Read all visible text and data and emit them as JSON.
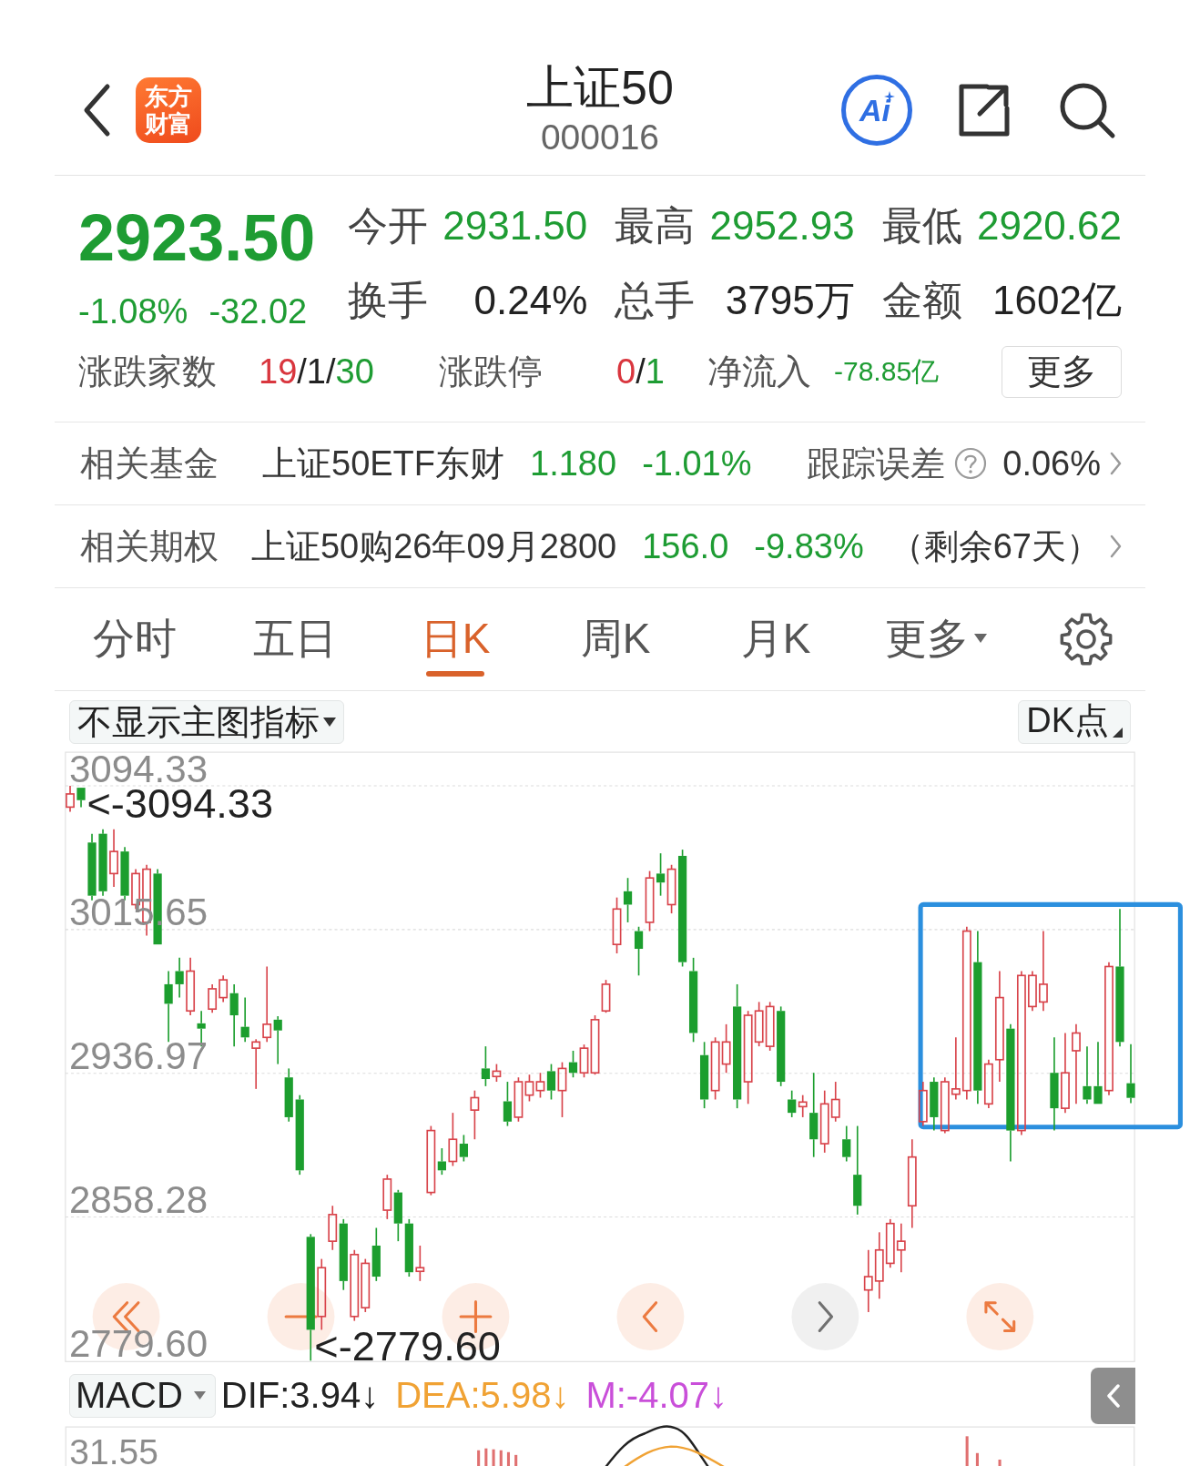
{
  "header": {
    "logo_text": "东方财富",
    "title": "上证50",
    "code": "000016",
    "ai_label": "Ai"
  },
  "quote": {
    "price": "2923.50",
    "color": "#1e9c33",
    "change_percent": "-1.08%",
    "change": "-32.02",
    "stats": [
      {
        "label": "今开",
        "value": "2931.50",
        "color": "#1e9c33"
      },
      {
        "label": "最高",
        "value": "2952.93",
        "color": "#1e9c33"
      },
      {
        "label": "最低",
        "value": "2920.62",
        "color": "#1e9c33"
      },
      {
        "label": "换手",
        "value": "0.24%",
        "color": "#222222"
      },
      {
        "label": "总手",
        "value": "3795万",
        "color": "#222222"
      },
      {
        "label": "金额",
        "value": "1602亿",
        "color": "#222222"
      }
    ],
    "breadth": {
      "label": "涨跌家数",
      "parts": [
        {
          "text": "19",
          "color": "#d9363e"
        },
        {
          "text": "/1/",
          "color": "#222222"
        },
        {
          "text": "30",
          "color": "#1e9c33"
        }
      ]
    },
    "limits": {
      "label": "涨跌停",
      "parts": [
        {
          "text": "0",
          "color": "#d9363e"
        },
        {
          "text": "/",
          "color": "#222222"
        },
        {
          "text": "1",
          "color": "#1e9c33"
        }
      ]
    },
    "net_inflow": {
      "label": "净流入",
      "value": "-78.85亿",
      "color": "#1e9c33"
    },
    "more_button": "更多"
  },
  "related": [
    {
      "label": "相关基金",
      "name": "上证50ETF东财",
      "price": "1.180",
      "change": "-1.01%",
      "color": "#1e9c33",
      "extra_label": "跟踪误差",
      "help": true,
      "extra_value": "0.06%"
    },
    {
      "label": "相关期权",
      "name": "上证50购26年09月2800",
      "price": "156.0",
      "change": "-9.83%",
      "color": "#1e9c33",
      "help": false,
      "extra_value": "（剩余67天）"
    }
  ],
  "tabs": [
    {
      "label": "分时",
      "kind": "period",
      "selected": false
    },
    {
      "label": "五日",
      "kind": "period",
      "selected": false
    },
    {
      "label": "日K",
      "kind": "period",
      "selected": true
    },
    {
      "label": "周K",
      "kind": "period",
      "selected": false
    },
    {
      "label": "月K",
      "kind": "period",
      "selected": false
    },
    {
      "label": "更多",
      "kind": "menu",
      "selected": false
    }
  ],
  "chart": {
    "indicator_menu": "不显示主图指标",
    "dk_button": "DK点",
    "high_marker": "<-3094.33",
    "low_marker": "<-2779.60",
    "chart_data": {
      "type": "candlestick",
      "ohlc": [
        [
          3082.7,
          3094.33,
          3080.2,
          3089.9
        ],
        [
          3093.3,
          3093.3,
          3082.7,
          3086.5
        ],
        [
          3063.3,
          3068.1,
          3031.7,
          3034.2
        ],
        [
          3068.1,
          3070.5,
          3034.2,
          3036.6
        ],
        [
          3046.3,
          3070.5,
          3039.0,
          3058.4
        ],
        [
          3058.4,
          3060.8,
          3031.7,
          3034.2
        ],
        [
          3029.3,
          3048.7,
          3026.9,
          3046.3
        ],
        [
          3019.6,
          3051.1,
          3012.3,
          3048.7
        ],
        [
          3046.3,
          3048.7,
          3007.5,
          3007.5
        ],
        [
          2985.7,
          2992.9,
          2954.1,
          2975.0
        ],
        [
          2992.9,
          3000.2,
          2978.4,
          2985.7
        ],
        [
          2971.1,
          3000.2,
          2968.7,
          2992.9
        ],
        [
          2964.3,
          2971.1,
          2951.7,
          2961.4
        ],
        [
          2972.1,
          2985.7,
          2970.1,
          2983.2
        ],
        [
          2978.4,
          2990.5,
          2976.0,
          2988.1
        ],
        [
          2980.8,
          2985.7,
          2951.7,
          2968.7
        ],
        [
          2962.4,
          2978.4,
          2954.1,
          2956.6
        ],
        [
          2950.7,
          2955.6,
          2928.4,
          2954.1
        ],
        [
          2956.6,
          2995.4,
          2954.1,
          2963.8
        ],
        [
          2966.3,
          2968.2,
          2942.0,
          2960.4
        ],
        [
          2934.7,
          2939.6,
          2910.5,
          2912.9
        ],
        [
          2922.6,
          2925.0,
          2881.4,
          2883.8
        ],
        [
          2847.4,
          2848.9,
          2779.6,
          2796.5
        ],
        [
          2803.8,
          2835.3,
          2796.5,
          2830.5
        ],
        [
          2845.0,
          2864.4,
          2840.2,
          2859.6
        ],
        [
          2854.7,
          2857.1,
          2818.3,
          2823.2
        ],
        [
          2803.8,
          2840.2,
          2801.4,
          2837.7
        ],
        [
          2808.6,
          2835.3,
          2806.2,
          2832.9
        ],
        [
          2842.6,
          2852.3,
          2823.2,
          2825.6
        ],
        [
          2862.0,
          2881.4,
          2857.1,
          2879.0
        ],
        [
          2871.7,
          2873.1,
          2845.0,
          2854.7
        ],
        [
          2854.7,
          2857.1,
          2825.6,
          2828.0
        ],
        [
          2828.5,
          2842.6,
          2823.2,
          2830.5
        ],
        [
          2871.7,
          2908.1,
          2870.2,
          2905.6
        ],
        [
          2888.7,
          2895.9,
          2881.4,
          2883.8
        ],
        [
          2888.7,
          2915.3,
          2886.2,
          2900.8
        ],
        [
          2898.4,
          2903.2,
          2888.7,
          2891.1
        ],
        [
          2916.8,
          2927.5,
          2900.8,
          2923.6
        ],
        [
          2939.6,
          2951.7,
          2929.9,
          2933.8
        ],
        [
          2935.2,
          2942.0,
          2932.3,
          2938.1
        ],
        [
          2921.6,
          2932.3,
          2908.1,
          2910.5
        ],
        [
          2912.9,
          2934.7,
          2910.5,
          2932.3
        ],
        [
          2925.0,
          2936.2,
          2921.6,
          2932.3
        ],
        [
          2927.5,
          2937.2,
          2923.6,
          2932.3
        ],
        [
          2938.1,
          2942.0,
          2922.6,
          2927.5
        ],
        [
          2927.5,
          2943.0,
          2912.9,
          2939.6
        ],
        [
          2943.0,
          2949.3,
          2934.7,
          2937.2
        ],
        [
          2937.2,
          2952.7,
          2934.7,
          2950.7
        ],
        [
          2937.2,
          2968.7,
          2936.2,
          2966.3
        ],
        [
          2971.1,
          2988.1,
          2970.1,
          2985.7
        ],
        [
          3007.5,
          3033.2,
          3002.6,
          3026.9
        ],
        [
          3036.6,
          3043.9,
          3019.6,
          3029.3
        ],
        [
          3014.8,
          3017.2,
          2990.5,
          3005.1
        ],
        [
          3019.6,
          3047.7,
          3014.8,
          3043.9
        ],
        [
          3046.3,
          3057.4,
          3034.2,
          3041.4
        ],
        [
          3029.3,
          3051.1,
          3024.5,
          3048.7
        ],
        [
          3056.0,
          3059.4,
          2995.4,
          2997.8
        ],
        [
          2992.9,
          3000.2,
          2954.1,
          2959.0
        ],
        [
          2946.9,
          2954.1,
          2917.8,
          2922.6
        ],
        [
          2927.5,
          2956.6,
          2922.6,
          2954.1
        ],
        [
          2942.0,
          2963.8,
          2937.2,
          2954.1
        ],
        [
          2973.5,
          2985.7,
          2917.8,
          2922.6
        ],
        [
          2932.3,
          2971.1,
          2920.2,
          2968.7
        ],
        [
          2954.1,
          2976.0,
          2951.7,
          2971.1
        ],
        [
          2951.7,
          2976.0,
          2949.3,
          2973.5
        ],
        [
          2971.1,
          2973.5,
          2929.9,
          2932.3
        ],
        [
          2922.6,
          2927.5,
          2912.9,
          2915.3
        ],
        [
          2918.7,
          2925.0,
          2912.9,
          2921.2
        ],
        [
          2915.3,
          2937.2,
          2891.1,
          2900.8
        ],
        [
          2898.4,
          2927.5,
          2893.5,
          2920.2
        ],
        [
          2912.9,
          2932.3,
          2910.5,
          2922.6
        ],
        [
          2900.8,
          2908.1,
          2888.7,
          2891.1
        ],
        [
          2881.4,
          2908.1,
          2859.6,
          2864.4
        ],
        [
          2818.3,
          2840.2,
          2806.2,
          2825.6
        ],
        [
          2823.2,
          2849.9,
          2813.5,
          2840.2
        ],
        [
          2832.9,
          2857.1,
          2830.5,
          2854.7
        ],
        [
          2840.2,
          2854.7,
          2828.0,
          2845.0
        ],
        [
          2864.4,
          2900.8,
          2852.3,
          2891.1
        ],
        [
          2910.5,
          2932.3,
          2908.1,
          2927.5
        ],
        [
          2932.3,
          2934.7,
          2905.6,
          2912.9
        ],
        [
          2905.6,
          2934.7,
          2904.2,
          2932.3
        ],
        [
          2925.5,
          2956.6,
          2922.6,
          2928.4
        ],
        [
          2927.5,
          3017.2,
          2922.6,
          3014.8
        ],
        [
          2997.8,
          3014.8,
          2920.2,
          2927.5
        ],
        [
          2920.2,
          2944.4,
          2917.8,
          2942.0
        ],
        [
          2944.4,
          2992.9,
          2932.3,
          2978.4
        ],
        [
          2961.4,
          2963.8,
          2888.7,
          2905.6
        ],
        [
          2905.6,
          2992.9,
          2903.2,
          2990.5
        ],
        [
          2973.5,
          2992.9,
          2971.1,
          2990.5
        ],
        [
          2976.0,
          3014.8,
          2971.1,
          2985.7
        ],
        [
          2937.2,
          2956.6,
          2905.6,
          2917.8
        ],
        [
          2917.8,
          2959.0,
          2915.3,
          2937.2
        ],
        [
          2949.3,
          2963.8,
          2920.2,
          2959.0
        ],
        [
          2929.9,
          2951.7,
          2920.2,
          2922.6
        ],
        [
          2929.9,
          2954.1,
          2920.2,
          2920.2
        ],
        [
          2927.5,
          2997.8,
          2925.0,
          2995.4
        ],
        [
          2995.4,
          3026.9,
          2951.7,
          2954.1
        ],
        [
          2931.5,
          2952.93,
          2920.62,
          2923.5
        ]
      ],
      "ylim": [
        2779.6,
        3112.75
      ],
      "yticks": [
        {
          "value": 3094.33,
          "label": "3094.33"
        },
        {
          "value": 3015.65,
          "label": "3015.65"
        },
        {
          "value": 2936.97,
          "label": "2936.97"
        },
        {
          "value": 2858.28,
          "label": "2858.28"
        },
        {
          "value": 2779.6,
          "label": "2779.60"
        }
      ],
      "grid": true
    },
    "controls": [
      {
        "kind": "rewind",
        "disabled": false
      },
      {
        "kind": "zoom_out",
        "disabled": false
      },
      {
        "kind": "zoom_in",
        "disabled": false
      },
      {
        "kind": "previous",
        "disabled": false
      },
      {
        "kind": "next",
        "disabled": true
      },
      {
        "kind": "fullscreen",
        "disabled": false
      }
    ]
  },
  "macd": {
    "selector": "MACD",
    "values": [
      {
        "text": "DIF:3.94↓",
        "color": "#222222"
      },
      {
        "text": "DEA:5.98↓",
        "color": "#f0a234"
      },
      {
        "text": "M:-4.07↓",
        "color": "#c94fd9"
      }
    ],
    "y_axis_label": "31.55"
  }
}
